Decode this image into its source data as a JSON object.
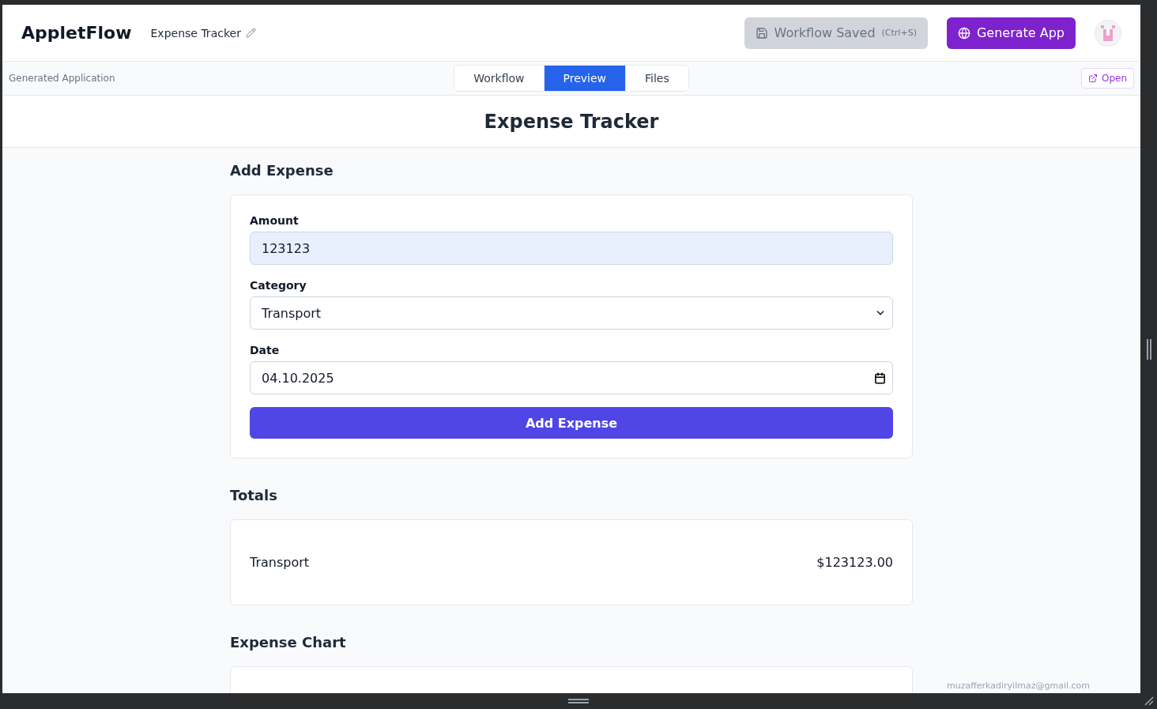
{
  "header": {
    "brand": "AppletFlow",
    "project": "Expense Tracker",
    "save_button": {
      "label": "Workflow Saved",
      "shortcut": "(Ctrl+S)",
      "disabled": true
    },
    "generate_button": "Generate App"
  },
  "toolbar": {
    "caption": "Generated Application",
    "tabs": [
      {
        "label": "Workflow",
        "selected": false
      },
      {
        "label": "Preview",
        "selected": true
      },
      {
        "label": "Files",
        "selected": false
      }
    ],
    "open_button": "Open"
  },
  "app": {
    "title": "Expense Tracker",
    "add_section": {
      "heading": "Add Expense",
      "fields": [
        {
          "kind": "text",
          "label": "Amount",
          "value": "123123",
          "autofilled": true
        },
        {
          "kind": "select",
          "label": "Category",
          "value": "Transport"
        },
        {
          "kind": "date",
          "label": "Date",
          "value": "04.10.2025"
        }
      ],
      "submit": "Add Expense"
    },
    "totals_section": {
      "heading": "Totals",
      "rows": [
        {
          "category": "Transport",
          "amount": "$123123.00"
        }
      ]
    },
    "chart_section": {
      "heading": "Expense Chart"
    }
  },
  "footer_email": "muzafferkadiryilmaz@gmail.com"
}
